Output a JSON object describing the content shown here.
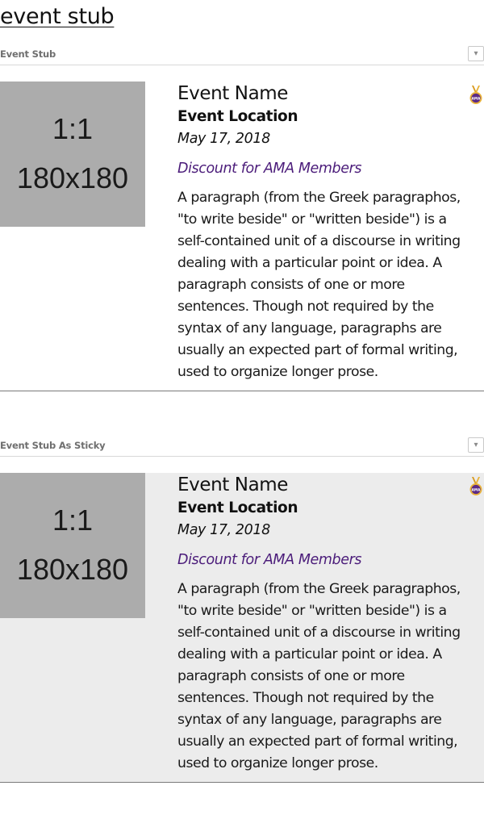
{
  "page": {
    "heading": "event stub"
  },
  "sections": [
    {
      "label": "Event Stub",
      "toggle_icon": "chevron-down-icon",
      "toggle_glyph": "▾",
      "event": {
        "thumbnail": {
          "ratio": "1:1",
          "size": "180x180",
          "background": "#acacac"
        },
        "name": "Event Name",
        "location": "Event Location",
        "date": "May 17, 2018",
        "discount": "Discount for AMA Members",
        "description": "A paragraph (from the Greek paragraphos, \"to write beside\" or \"written beside\") is a self-contained unit of a discourse in writing dealing with a particular point or idea. A paragraph consists of one or more sentences. Though not required by the syntax of any language, paragraphs are usually an expected part of formal writing, used to organize longer prose.",
        "badge_icon": "medal-icon",
        "sticky": false
      }
    },
    {
      "label": "Event Stub As Sticky",
      "toggle_icon": "chevron-down-icon",
      "toggle_glyph": "▾",
      "event": {
        "thumbnail": {
          "ratio": "1:1",
          "size": "180x180",
          "background": "#acacac"
        },
        "name": "Event Name",
        "location": "Event Location",
        "date": "May 17, 2018",
        "discount": "Discount for AMA Members",
        "description": "A paragraph (from the Greek paragraphos, \"to write beside\" or \"written beside\") is a self-contained unit of a discourse in writing dealing with a particular point or idea. A paragraph consists of one or more sentences. Though not required by the syntax of any language, paragraphs are usually an expected part of formal writing, used to organize longer prose.",
        "badge_icon": "medal-icon",
        "sticky": true
      }
    }
  ],
  "colors": {
    "discount_text": "#4b1c7a",
    "sticky_background": "#ececec",
    "medal_ribbon": "#d99a1e",
    "medal_disc": "#5b2a86"
  }
}
